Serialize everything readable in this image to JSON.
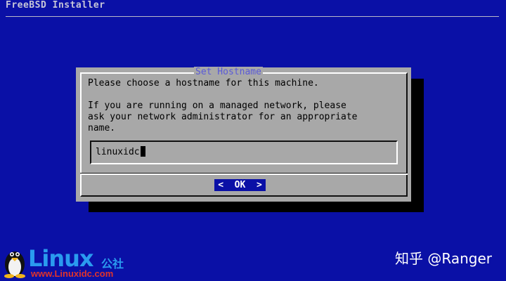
{
  "window": {
    "title": "FreeBSD Installer"
  },
  "dialog": {
    "title": "Set Hostname",
    "message": "Please choose a hostname for this machine.\n\nIf you are running on a managed network, please\nask your network administrator for an appropriate\nname.",
    "input_value": "linuxidc",
    "ok_label": "<  OK  >"
  },
  "overlay": {
    "logo_word": "Linux",
    "logo_cn": "公社",
    "logo_url": "www.Linuxidc.com",
    "watermark": "知乎 @Ranger"
  },
  "colors": {
    "background": "#0a10a6",
    "dialog": "#a8a8a8",
    "title_text": "#5a5ad8",
    "button": "#0a10a6"
  }
}
